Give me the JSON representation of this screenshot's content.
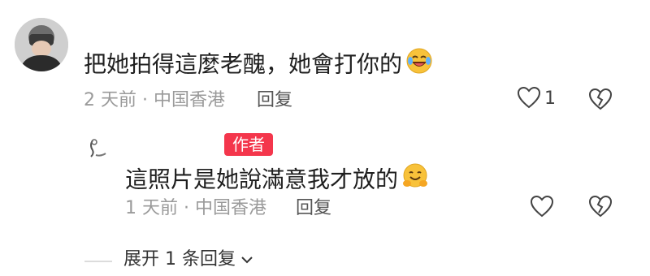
{
  "comments": [
    {
      "text": "把她拍得這麼老醜，她會打你的",
      "emoji_icon": "laughing-crying-face-icon",
      "meta": "2 天前 · 中国香港",
      "reply_label": "回复",
      "like_count": "1"
    },
    {
      "author_badge": "作者",
      "text": "這照片是她說滿意我才放的",
      "emoji_icon": "hugging-face-icon",
      "meta": "1 天前 · 中国香港",
      "reply_label": "回复"
    }
  ],
  "expand_replies": {
    "label": "展开 1 条回复"
  },
  "colors": {
    "badge_bg": "#f4364c",
    "meta_text": "#9a9a9a",
    "emoji_yellow": "#f8c23a"
  }
}
